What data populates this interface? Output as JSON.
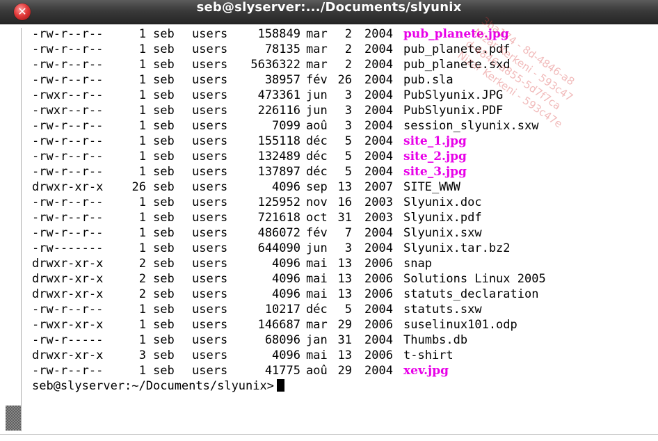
{
  "window": {
    "title": "seb@slyserver:.../Documents/slyunix",
    "close_icon": "close-icon",
    "close_glyph": "✕"
  },
  "colors": {
    "image": "#e800e8",
    "executable": "#22b422",
    "directory": "#1a2fd6",
    "archive": "#d40000",
    "plain": "#000000"
  },
  "listing": [
    {
      "perm": "-rw-r--r--",
      "links": "1",
      "owner": "seb",
      "group": "users",
      "size": "158849",
      "month": "mar",
      "day": "2",
      "year": "2004",
      "name": "pub_planete.jpg",
      "kind": "image"
    },
    {
      "perm": "-rw-r--r--",
      "links": "1",
      "owner": "seb",
      "group": "users",
      "size": "78135",
      "month": "mar",
      "day": "2",
      "year": "2004",
      "name": "pub_planete.pdf",
      "kind": "plain"
    },
    {
      "perm": "-rw-r--r--",
      "links": "1",
      "owner": "seb",
      "group": "users",
      "size": "5636322",
      "month": "mar",
      "day": "2",
      "year": "2004",
      "name": "pub_planete.sxd",
      "kind": "plain"
    },
    {
      "perm": "-rw-r--r--",
      "links": "1",
      "owner": "seb",
      "group": "users",
      "size": "38957",
      "month": "fév",
      "day": "26",
      "year": "2004",
      "name": "pub.sla",
      "kind": "plain"
    },
    {
      "perm": "-rwxr--r--",
      "links": "1",
      "owner": "seb",
      "group": "users",
      "size": "473361",
      "month": "jun",
      "day": "3",
      "year": "2004",
      "name": "PubSlyunix.JPG",
      "kind": "executable"
    },
    {
      "perm": "-rwxr--r--",
      "links": "1",
      "owner": "seb",
      "group": "users",
      "size": "226116",
      "month": "jun",
      "day": "3",
      "year": "2004",
      "name": "PubSlyunix.PDF",
      "kind": "executable"
    },
    {
      "perm": "-rw-r--r--",
      "links": "1",
      "owner": "seb",
      "group": "users",
      "size": "7099",
      "month": "aoû",
      "day": "3",
      "year": "2004",
      "name": "session_slyunix.sxw",
      "kind": "plain"
    },
    {
      "perm": "-rw-r--r--",
      "links": "1",
      "owner": "seb",
      "group": "users",
      "size": "155118",
      "month": "déc",
      "day": "5",
      "year": "2004",
      "name": "site_1.jpg",
      "kind": "image"
    },
    {
      "perm": "-rw-r--r--",
      "links": "1",
      "owner": "seb",
      "group": "users",
      "size": "132489",
      "month": "déc",
      "day": "5",
      "year": "2004",
      "name": "site_2.jpg",
      "kind": "image"
    },
    {
      "perm": "-rw-r--r--",
      "links": "1",
      "owner": "seb",
      "group": "users",
      "size": "137897",
      "month": "déc",
      "day": "5",
      "year": "2004",
      "name": "site_3.jpg",
      "kind": "image"
    },
    {
      "perm": "drwxr-xr-x",
      "links": "26",
      "owner": "seb",
      "group": "users",
      "size": "4096",
      "month": "sep",
      "day": "13",
      "year": "2007",
      "name": "SITE_WWW",
      "kind": "directory"
    },
    {
      "perm": "-rw-r--r--",
      "links": "1",
      "owner": "seb",
      "group": "users",
      "size": "125952",
      "month": "nov",
      "day": "16",
      "year": "2003",
      "name": "Slyunix.doc",
      "kind": "plain"
    },
    {
      "perm": "-rw-r--r--",
      "links": "1",
      "owner": "seb",
      "group": "users",
      "size": "721618",
      "month": "oct",
      "day": "31",
      "year": "2003",
      "name": "Slyunix.pdf",
      "kind": "plain"
    },
    {
      "perm": "-rw-r--r--",
      "links": "1",
      "owner": "seb",
      "group": "users",
      "size": "486072",
      "month": "fév",
      "day": "7",
      "year": "2004",
      "name": "Slyunix.sxw",
      "kind": "plain"
    },
    {
      "perm": "-rw-------",
      "links": "1",
      "owner": "seb",
      "group": "users",
      "size": "644090",
      "month": "jun",
      "day": "3",
      "year": "2004",
      "name": "Slyunix.tar.bz2",
      "kind": "archive"
    },
    {
      "perm": "drwxr-xr-x",
      "links": "2",
      "owner": "seb",
      "group": "users",
      "size": "4096",
      "month": "mai",
      "day": "13",
      "year": "2006",
      "name": "snap",
      "kind": "directory"
    },
    {
      "perm": "drwxr-xr-x",
      "links": "2",
      "owner": "seb",
      "group": "users",
      "size": "4096",
      "month": "mai",
      "day": "13",
      "year": "2006",
      "name": "Solutions Linux 2005",
      "kind": "directory"
    },
    {
      "perm": "drwxr-xr-x",
      "links": "2",
      "owner": "seb",
      "group": "users",
      "size": "4096",
      "month": "mai",
      "day": "13",
      "year": "2006",
      "name": "statuts_declaration",
      "kind": "directory"
    },
    {
      "perm": "-rw-r--r--",
      "links": "1",
      "owner": "seb",
      "group": "users",
      "size": "10217",
      "month": "déc",
      "day": "5",
      "year": "2004",
      "name": "statuts.sxw",
      "kind": "plain"
    },
    {
      "perm": "-rwxr-xr-x",
      "links": "1",
      "owner": "seb",
      "group": "users",
      "size": "146687",
      "month": "mar",
      "day": "29",
      "year": "2006",
      "name": "suselinux101.odp",
      "kind": "executable"
    },
    {
      "perm": "-rw-r-----",
      "links": "1",
      "owner": "seb",
      "group": "users",
      "size": "68096",
      "month": "jan",
      "day": "31",
      "year": "2004",
      "name": "Thumbs.db",
      "kind": "plain"
    },
    {
      "perm": "drwxr-xr-x",
      "links": "3",
      "owner": "seb",
      "group": "users",
      "size": "4096",
      "month": "mai",
      "day": "13",
      "year": "2006",
      "name": "t-shirt",
      "kind": "directory"
    },
    {
      "perm": "-rw-r--r--",
      "links": "1",
      "owner": "seb",
      "group": "users",
      "size": "41775",
      "month": "aoû",
      "day": "29",
      "year": "2004",
      "name": "xev.jpg",
      "kind": "image"
    }
  ],
  "prompt": {
    "text": "seb@slyserver:~/Documents/slyunix>"
  },
  "watermark": {
    "text": "3ba174 - 8d-4846-a8\nNizar Kerkeni - 593c47\nd-4846-a855-5d7f7ca\nNizar Kerkeni - 593c47e"
  }
}
